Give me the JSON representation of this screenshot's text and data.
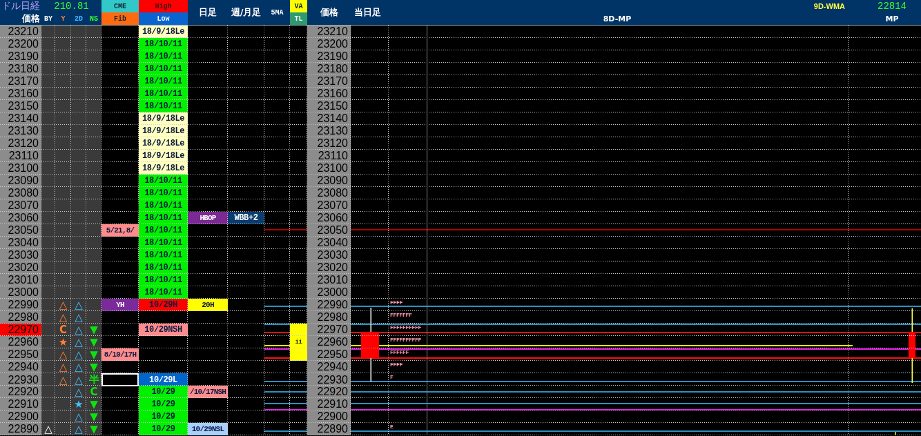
{
  "header": {
    "title": "ドル日経",
    "rate": "210.81",
    "price_label": "価格",
    "mark_columns": [
      "BY",
      "Y",
      "2D",
      "NS"
    ],
    "cme": "CME",
    "fib": "Fib",
    "high": "High",
    "low": "Low",
    "daily": "日足",
    "weekly_monthly": "週/月足",
    "ma5": "5MA",
    "va": "VA",
    "tl": "TL",
    "price_label_2": "価格",
    "today_bar": "当日足",
    "wma_label": "9D-WMA",
    "wma_value": "22814",
    "mp_label": "8D-MP",
    "mp": "MP"
  },
  "rows": [
    {
      "price": "23210",
      "current": false,
      "selected": false,
      "high_low": {
        "text": "18/9/18Le",
        "color": "#ffffc0"
      },
      "price_2": "23210"
    },
    {
      "price": "23200",
      "current": false,
      "selected": false,
      "high_low": {
        "text": "18/10/11",
        "color": "#00f000"
      },
      "price_2": "23200"
    },
    {
      "price": "23190",
      "current": false,
      "selected": false,
      "high_low": {
        "text": "18/10/11",
        "color": "#00f000"
      },
      "price_2": "23190"
    },
    {
      "price": "23180",
      "current": false,
      "selected": false,
      "high_low": {
        "text": "18/10/11",
        "color": "#00f000"
      },
      "price_2": "23180"
    },
    {
      "price": "23170",
      "current": false,
      "selected": false,
      "high_low": {
        "text": "18/10/11",
        "color": "#00f000"
      },
      "price_2": "23170"
    },
    {
      "price": "23160",
      "current": false,
      "selected": false,
      "high_low": {
        "text": "18/10/11",
        "color": "#00f000"
      },
      "price_2": "23160"
    },
    {
      "price": "23150",
      "current": false,
      "selected": false,
      "high_low": {
        "text": "18/10/11",
        "color": "#00f000"
      },
      "price_2": "23150"
    },
    {
      "price": "23140",
      "current": false,
      "selected": false,
      "high_low": {
        "text": "18/9/18Le",
        "color": "#ffffc0"
      },
      "price_2": "23140"
    },
    {
      "price": "23130",
      "current": false,
      "selected": false,
      "high_low": {
        "text": "18/9/18Le",
        "color": "#ffffc0"
      },
      "price_2": "23130"
    },
    {
      "price": "23120",
      "current": false,
      "selected": false,
      "high_low": {
        "text": "18/9/18Le",
        "color": "#ffffc0"
      },
      "price_2": "23120"
    },
    {
      "price": "23110",
      "current": false,
      "selected": false,
      "high_low": {
        "text": "18/9/18Le",
        "color": "#ffffc0"
      },
      "price_2": "23110"
    },
    {
      "price": "23100",
      "current": false,
      "selected": false,
      "high_low": {
        "text": "18/9/18Le",
        "color": "#ffffc0"
      },
      "price_2": "23100"
    },
    {
      "price": "23090",
      "current": false,
      "selected": false,
      "high_low": {
        "text": "18/10/11",
        "color": "#00f000"
      },
      "price_2": "23090"
    },
    {
      "price": "23080",
      "current": false,
      "selected": false,
      "high_low": {
        "text": "18/10/11",
        "color": "#00f000"
      },
      "price_2": "23080"
    },
    {
      "price": "23070",
      "current": false,
      "selected": false,
      "high_low": {
        "text": "18/10/11",
        "color": "#00f000"
      },
      "price_2": "23070"
    },
    {
      "price": "23060",
      "current": false,
      "selected": false,
      "high_low": {
        "text": "18/10/11",
        "color": "#00f000"
      },
      "daily": {
        "text": "HBOP",
        "color": "#7a2a92"
      },
      "weekly": {
        "text": "WBB+2",
        "color": "#0b3c6e"
      },
      "price_2": "23060"
    },
    {
      "price": "23050",
      "current": false,
      "selected": false,
      "cme": {
        "text": "5/21,8/",
        "color": "#ff8c8c"
      },
      "high_low": {
        "text": "18/10/11",
        "color": "#00f000"
      },
      "price_2": "23050"
    },
    {
      "price": "23040",
      "current": false,
      "selected": false,
      "high_low": {
        "text": "18/10/11",
        "color": "#00f000"
      },
      "price_2": "23040"
    },
    {
      "price": "23030",
      "current": false,
      "selected": false,
      "high_low": {
        "text": "18/10/11",
        "color": "#00f000"
      },
      "price_2": "23030"
    },
    {
      "price": "23020",
      "current": false,
      "selected": false,
      "high_low": {
        "text": "18/10/11",
        "color": "#00f000"
      },
      "price_2": "23020"
    },
    {
      "price": "23010",
      "current": false,
      "selected": false,
      "high_low": {
        "text": "18/10/11",
        "color": "#00f000"
      },
      "price_2": "23010"
    },
    {
      "price": "23000",
      "current": false,
      "selected": false,
      "high_low": {
        "text": "18/10/11",
        "color": "#00f000"
      },
      "price_2": "23000"
    },
    {
      "price": "22990",
      "current": false,
      "selected": false,
      "y": "△",
      "d2": "△",
      "cme": {
        "text": "YH",
        "color": "#7a2a9a"
      },
      "high_low": {
        "text": "10/29H",
        "color": "#ff0000"
      },
      "daily": {
        "text": "20H",
        "color": "#ffff00"
      },
      "price_2": "22990",
      "tpo": "FFFF"
    },
    {
      "price": "22980",
      "current": false,
      "selected": false,
      "y": "△",
      "d2": "△",
      "price_2": "22980",
      "tpo": "FFFFFFF"
    },
    {
      "price": "22970",
      "current": true,
      "selected": false,
      "y": "C",
      "d2": "△",
      "ns": "▼",
      "high_low": {
        "text": "10/29NSH",
        "color": "#ff8c8c"
      },
      "va": {
        "color": "#ffff00"
      },
      "price_2": "22970",
      "tpo": "FFFFFFFFFF"
    },
    {
      "price": "22960",
      "current": false,
      "selected": false,
      "y": "★",
      "d2": "△",
      "ns": "▼",
      "va": {
        "color": "#ffff00",
        "text": "ii"
      },
      "price_2": "22960",
      "tpo": "FFFFFFFFFF"
    },
    {
      "price": "22950",
      "current": false,
      "selected": false,
      "y": "△",
      "d2": "△",
      "ns": "▼",
      "cme": {
        "text": "8/10/17H",
        "color": "#ff8c8c"
      },
      "va": {
        "color": "#ffff00"
      },
      "price_2": "22950",
      "tpo": "FFFFFF"
    },
    {
      "price": "22940",
      "current": false,
      "selected": false,
      "y": "△",
      "d2": "△",
      "ns": "▼",
      "price_2": "22940",
      "tpo": "FFFF"
    },
    {
      "price": "22930",
      "current": false,
      "selected": true,
      "y": "△",
      "d2": "△",
      "ns": "半",
      "high_low": {
        "text": "10/29L",
        "color": "#0066cc"
      },
      "price_2": "22930",
      "tpo": "F"
    },
    {
      "price": "22920",
      "current": false,
      "selected": false,
      "d2": "△",
      "ns": "C",
      "high_low": {
        "text": "10/29",
        "color": "#00f000"
      },
      "daily": {
        "text": "/10/17NSH",
        "color": "#ff8c8c"
      },
      "price_2": "22920"
    },
    {
      "price": "22910",
      "current": false,
      "selected": false,
      "d2": "★",
      "ns": "▼",
      "high_low": {
        "text": "10/29",
        "color": "#00f000"
      },
      "price_2": "22910"
    },
    {
      "price": "22900",
      "current": false,
      "selected": false,
      "d2": "△",
      "ns": "▼",
      "high_low": {
        "text": "10/29",
        "color": "#00f000"
      },
      "price_2": "22900"
    },
    {
      "price": "22890",
      "current": false,
      "selected": false,
      "by": "△",
      "d2": "△",
      "ns": "▼",
      "high_low": {
        "text": "10/29",
        "color": "#00f000"
      },
      "daily": {
        "text": "10/29NSL",
        "color": "#a8d0ff"
      },
      "price_2": "22890",
      "tpo": "E"
    }
  ]
}
